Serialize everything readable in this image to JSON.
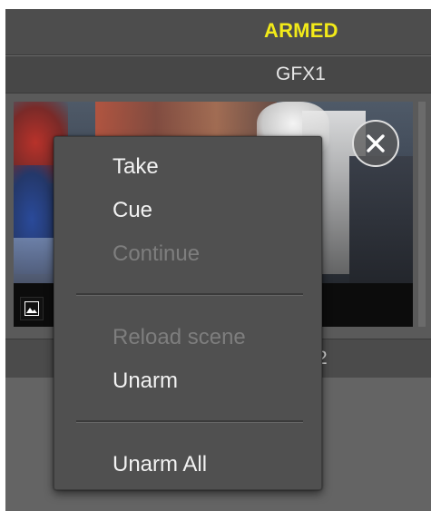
{
  "header": {
    "status": "ARMED",
    "channel": "GFX1"
  },
  "thumbnail": {
    "close_icon": "close-circle-icon",
    "type_icon": "image-icon"
  },
  "lower": {
    "label": "2"
  },
  "context_menu": {
    "items": [
      {
        "label": "Take",
        "enabled": true
      },
      {
        "label": "Cue",
        "enabled": true
      },
      {
        "label": "Continue",
        "enabled": false
      },
      {
        "label": "Reload scene",
        "enabled": false
      },
      {
        "label": "Unarm",
        "enabled": true
      },
      {
        "label": "Unarm All",
        "enabled": true
      }
    ]
  },
  "colors": {
    "armed": "#f2ea19",
    "panel": "#5e5e5e",
    "menu_bg": "#505050",
    "menu_text": "#f2f2f2",
    "menu_disabled": "#7e7e7e"
  }
}
